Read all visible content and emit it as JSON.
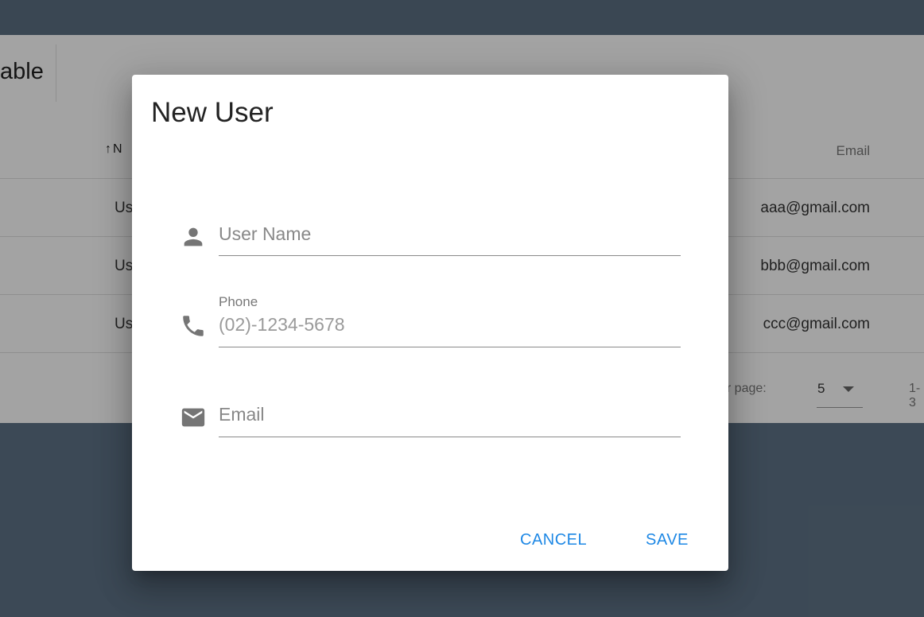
{
  "background": {
    "table_title": "able",
    "sorted_column_header": "N",
    "email_column_header": "Email",
    "rows": [
      {
        "name": "Us",
        "email": "aaa@gmail.com"
      },
      {
        "name": "Us",
        "email": "bbb@gmail.com"
      },
      {
        "name": "Us",
        "email": "ccc@gmail.com"
      }
    ],
    "footer": {
      "rows_per_page_label": "er page:",
      "rows_per_page_value": "5",
      "range_text": "1-3"
    }
  },
  "dialog": {
    "title": "New User",
    "fields": {
      "user_name": {
        "placeholder": "User Name",
        "value": "",
        "icon": "person-icon"
      },
      "phone": {
        "label": "Phone",
        "placeholder": "(02)-1234-5678",
        "value": "",
        "icon": "phone-icon"
      },
      "email": {
        "placeholder": "Email",
        "value": "",
        "icon": "email-icon"
      }
    },
    "actions": {
      "cancel_label": "CANCEL",
      "save_label": "SAVE"
    }
  },
  "colors": {
    "accent": "#1e88e5",
    "backdrop": "#5f7387",
    "icon": "#757575"
  }
}
